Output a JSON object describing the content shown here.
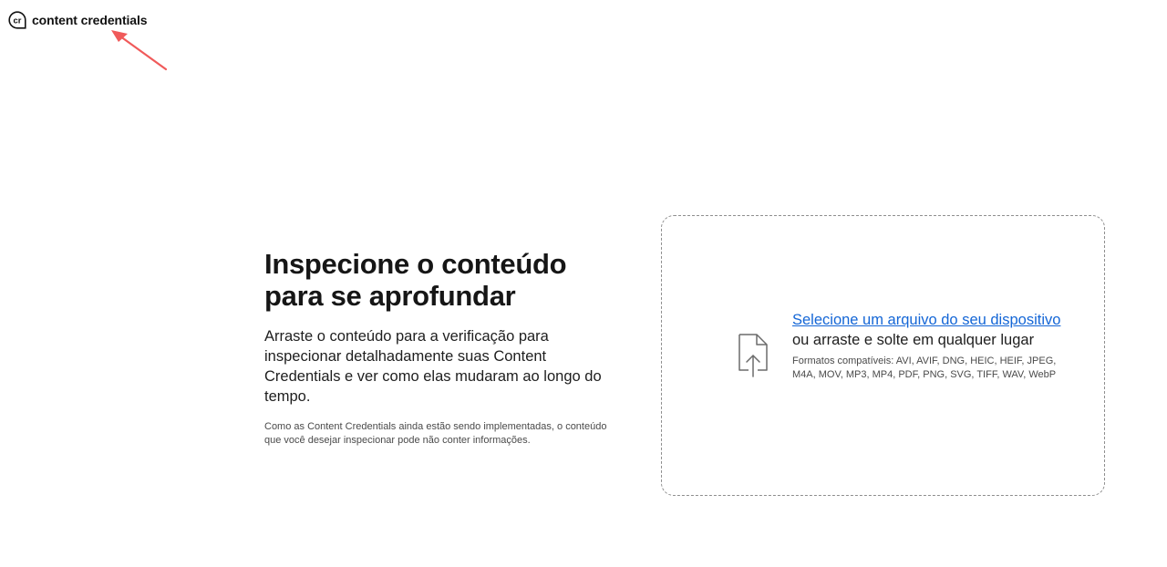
{
  "header": {
    "logo_text": "content credentials",
    "logo_mark_text": "cr"
  },
  "intro": {
    "title_line1": "Inspecione o conteúdo",
    "title_line2": "para se aprofundar",
    "lead": "Arraste o conteúdo para a verificação para inspecionar detalhadamente suas Content Credentials e ver como elas mudaram ao longo do tempo.",
    "note": "Como as Content Credentials ainda estão sendo implementadas, o conteúdo que você desejar inspecionar pode não conter informações."
  },
  "dropzone": {
    "select_link": "Selecione um arquivo do seu dispositivo",
    "drag_text": "ou arraste e solte em qualquer lugar",
    "formats": "Formatos compatíveis: AVI, AVIF, DNG, HEIC, HEIF, JPEG, M4A, MOV, MP3, MP4, PDF, PNG, SVG, TIFF, WAV, WebP",
    "icon": "file-upload-icon"
  },
  "colors": {
    "link": "#1466d6",
    "annotation_arrow": "#f05a5a",
    "dashed_border": "#8e8e8e"
  }
}
